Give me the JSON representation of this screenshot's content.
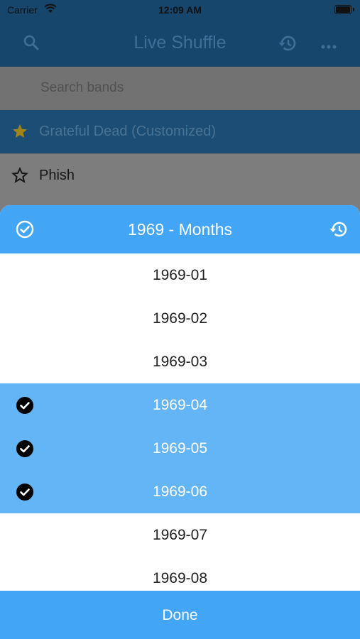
{
  "status_bar": {
    "carrier": "Carrier",
    "time": "12:09 AM"
  },
  "nav": {
    "title": "Live Shuffle"
  },
  "search": {
    "placeholder": "Search bands"
  },
  "bands": [
    {
      "name": "Grateful Dead (Customized)",
      "starred": true
    },
    {
      "name": "Phish",
      "starred": false
    }
  ],
  "sheet": {
    "title": "1969 - Months",
    "months": [
      {
        "label": "1969-01",
        "selected": false
      },
      {
        "label": "1969-02",
        "selected": false
      },
      {
        "label": "1969-03",
        "selected": false
      },
      {
        "label": "1969-04",
        "selected": true
      },
      {
        "label": "1969-05",
        "selected": true
      },
      {
        "label": "1969-06",
        "selected": true
      },
      {
        "label": "1969-07",
        "selected": false
      },
      {
        "label": "1969-08",
        "selected": false
      }
    ],
    "done_label": "Done"
  },
  "colors": {
    "accent": "#42a5f5",
    "selected_row": "#64b5f6",
    "nav_dimmed": "#17466d",
    "star_gold": "#a08416"
  },
  "icons": {
    "search": "search-icon",
    "history": "history-icon",
    "more": "more-icon",
    "select_all": "check-circle-outline-icon",
    "reset": "history-icon",
    "checked": "check-circle-icon",
    "star": "star-icon"
  }
}
